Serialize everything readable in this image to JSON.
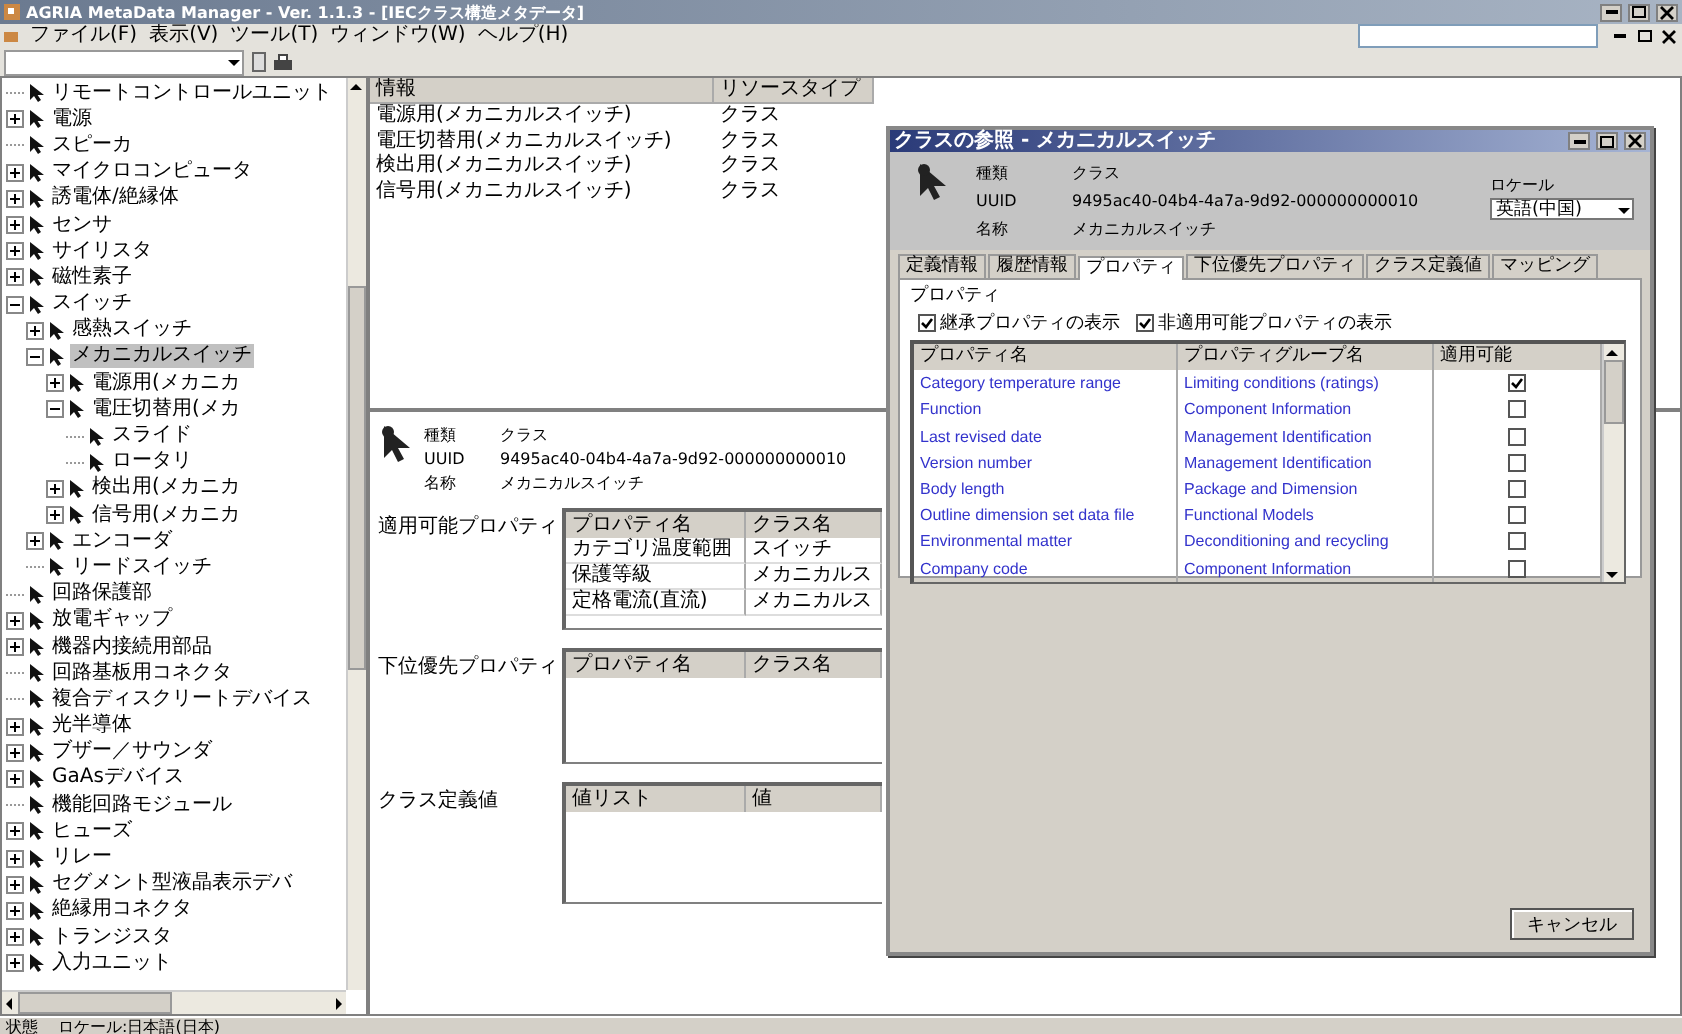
{
  "window": {
    "title": "AGRIA MetaData Manager - Ver. 1.1.3 - [IECクラス構造メタデータ]"
  },
  "menu": [
    "ファイル(F)",
    "表示(V)",
    "ツール(T)",
    "ウィンドウ(W)",
    "ヘルプ(H)"
  ],
  "tree": {
    "items": [
      {
        "label": "リモートコントロールユニット",
        "kind": "leaf",
        "selected": false
      },
      {
        "label": "電源",
        "kind": "node",
        "expanded": false,
        "selected": false
      },
      {
        "label": "スピーカ",
        "kind": "leaf",
        "selected": false
      },
      {
        "label": "マイクロコンピュータ",
        "kind": "node",
        "expanded": false,
        "selected": false
      },
      {
        "label": "誘電体/絶縁体",
        "kind": "node",
        "expanded": false,
        "selected": false
      },
      {
        "label": "センサ",
        "kind": "node",
        "expanded": false,
        "selected": false
      },
      {
        "label": "サイリスタ",
        "kind": "node",
        "expanded": false,
        "selected": false
      },
      {
        "label": "磁性素子",
        "kind": "node",
        "expanded": false,
        "selected": false
      },
      {
        "label": "スイッチ",
        "kind": "node",
        "expanded": true,
        "selected": false,
        "children": [
          {
            "label": "感熱スイッチ",
            "kind": "node",
            "expanded": false,
            "selected": false
          },
          {
            "label": "メカニカルスイッチ",
            "kind": "node",
            "expanded": true,
            "selected": true,
            "children": [
              {
                "label": "電源用(メカニカ",
                "kind": "node",
                "expanded": false,
                "selected": false
              },
              {
                "label": "電圧切替用(メカ",
                "kind": "node",
                "expanded": true,
                "selected": false,
                "children": [
                  {
                    "label": "スライド",
                    "kind": "leaf",
                    "selected": false
                  },
                  {
                    "label": "ロータリ",
                    "kind": "leaf",
                    "selected": false
                  }
                ]
              },
              {
                "label": "検出用(メカニカ",
                "kind": "node",
                "expanded": false,
                "selected": false
              },
              {
                "label": "信号用(メカニカ",
                "kind": "node",
                "expanded": false,
                "selected": false
              }
            ]
          },
          {
            "label": "エンコーダ",
            "kind": "node",
            "expanded": false,
            "selected": false
          },
          {
            "label": "リードスイッチ",
            "kind": "leaf",
            "selected": false
          }
        ]
      },
      {
        "label": "回路保護部",
        "kind": "leaf",
        "selected": false
      },
      {
        "label": "放電ギャップ",
        "kind": "node",
        "expanded": false,
        "selected": false
      },
      {
        "label": "機器内接続用部品",
        "kind": "node",
        "expanded": false,
        "selected": false
      },
      {
        "label": "回路基板用コネクタ",
        "kind": "leaf",
        "selected": false
      },
      {
        "label": "複合ディスクリートデバイス",
        "kind": "leaf",
        "selected": false
      },
      {
        "label": "光半導体",
        "kind": "node",
        "expanded": false,
        "selected": false
      },
      {
        "label": "ブザー／サウンダ",
        "kind": "node",
        "expanded": false,
        "selected": false
      },
      {
        "label": "GaAsデバイス",
        "kind": "node",
        "expanded": false,
        "selected": false
      },
      {
        "label": "機能回路モジュール",
        "kind": "leaf",
        "selected": false
      },
      {
        "label": "ヒューズ",
        "kind": "node",
        "expanded": false,
        "selected": false
      },
      {
        "label": "リレー",
        "kind": "node",
        "expanded": false,
        "selected": false
      },
      {
        "label": "セグメント型液晶表示デバ",
        "kind": "node",
        "expanded": false,
        "selected": false
      },
      {
        "label": "絶縁用コネクタ",
        "kind": "node",
        "expanded": false,
        "selected": false
      },
      {
        "label": "トランジスタ",
        "kind": "node",
        "expanded": false,
        "selected": false
      },
      {
        "label": "入力ユニット",
        "kind": "node",
        "expanded": false,
        "selected": false
      }
    ]
  },
  "resource_list": {
    "columns": [
      "情報",
      "リソースタイプ"
    ],
    "rows": [
      [
        "電源用(メカニカルスイッチ)",
        "クラス"
      ],
      [
        "電圧切替用(メカニカルスイッチ)",
        "クラス"
      ],
      [
        "検出用(メカニカルスイッチ)",
        "クラス"
      ],
      [
        "信号用(メカニカルスイッチ)",
        "クラス"
      ]
    ]
  },
  "detail": {
    "fields": [
      {
        "label": "種類",
        "value": "クラス"
      },
      {
        "label": "UUID",
        "value": "9495ac40-04b4-4a7a-9d92-000000000010"
      },
      {
        "label": "名称",
        "value": "メカニカルスイッチ"
      }
    ],
    "sections": [
      {
        "label": "適用可能プロパティ",
        "columns": [
          "プロパティ名",
          "クラス名"
        ],
        "rows": [
          [
            "カテゴリ温度範囲",
            "スイッチ"
          ],
          [
            "保護等級",
            "メカニカルス"
          ],
          [
            "定格電流(直流)",
            "メカニカルス"
          ]
        ]
      },
      {
        "label": "下位優先プロパティ",
        "columns": [
          "プロパティ名",
          "クラス名"
        ]
      },
      {
        "label": "クラス定義値",
        "columns": [
          "値リスト",
          "値"
        ]
      }
    ]
  },
  "dialog": {
    "title": "クラスの参照 - メカニカルスイッチ",
    "fields": [
      {
        "label": "種類",
        "value": "クラス"
      },
      {
        "label": "UUID",
        "value": "9495ac40-04b4-4a7a-9d92-000000000010"
      },
      {
        "label": "名称",
        "value": "メカニカルスイッチ"
      }
    ],
    "locale": {
      "label": "ロケール",
      "value": "英語(中国)"
    },
    "tabs": [
      {
        "label": "定義情報",
        "selected": false
      },
      {
        "label": "履歴情報",
        "selected": false
      },
      {
        "label": "プロパティ",
        "selected": true
      },
      {
        "label": "下位優先プロパティ",
        "selected": false
      },
      {
        "label": "クラス定義値",
        "selected": false
      },
      {
        "label": "マッピング",
        "selected": false
      }
    ],
    "group": {
      "title": "プロパティ",
      "options": [
        {
          "label": "継承プロパティの表示",
          "checked": true
        },
        {
          "label": "非適用可能プロパティの表示",
          "checked": true
        }
      ],
      "columns": [
        "プロパティ名",
        "プロパティグループ名",
        "適用可能"
      ],
      "rows": [
        {
          "name": "Category temperature range",
          "group": "Limiting conditions (ratings)",
          "applicable": true
        },
        {
          "name": "Function",
          "group": "Component Information",
          "applicable": false
        },
        {
          "name": "Last revised date",
          "group": "Management Identification",
          "applicable": false
        },
        {
          "name": "Version number",
          "group": "Management Identification",
          "applicable": false
        },
        {
          "name": "Body length",
          "group": "Package and Dimension",
          "applicable": false
        },
        {
          "name": "Outline dimension set data file",
          "group": "Functional Models",
          "applicable": false
        },
        {
          "name": "Environmental matter",
          "group": "Deconditioning and recycling",
          "applicable": false
        },
        {
          "name": "Company code",
          "group": "Component Information",
          "applicable": false
        }
      ]
    },
    "buttons": [
      "キャンセル"
    ]
  },
  "status_bar": [
    "状態",
    "ロケール:日本語(日本)"
  ]
}
